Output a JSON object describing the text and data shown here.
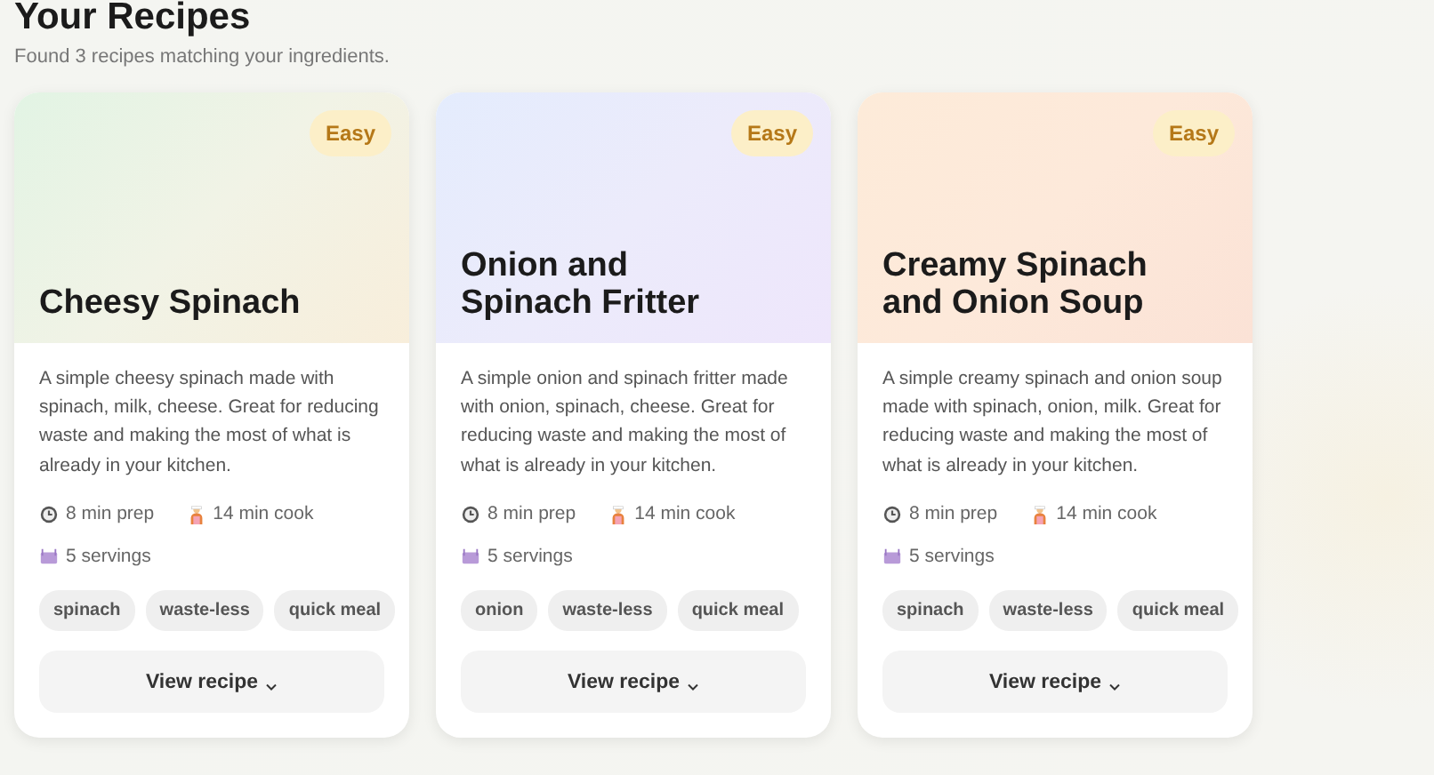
{
  "title": "Your Recipes",
  "subtitle": "Found 3 recipes matching your ingredients.",
  "recipes": [
    {
      "difficulty": "Easy",
      "name": "Cheesy Spinach",
      "description": "A simple cheesy spinach made with spinach, milk, cheese. Great for reducing waste and making the most of what is already in your kitchen.",
      "prep": "8 min prep",
      "cook": "14 min cook",
      "servings": "5 servings",
      "tags": [
        "spinach",
        "waste-less",
        "quick meal"
      ],
      "action": "View recipe"
    },
    {
      "difficulty": "Easy",
      "name": "Onion and Spinach Fritter",
      "description": "A simple onion and spinach fritter made with onion, spinach, cheese. Great for reducing waste and making the most of what is already in your kitchen.",
      "prep": "8 min prep",
      "cook": "14 min cook",
      "servings": "5 servings",
      "tags": [
        "onion",
        "waste-less",
        "quick meal"
      ],
      "action": "View recipe"
    },
    {
      "difficulty": "Easy",
      "name": "Creamy Spinach and Onion Soup",
      "description": "A simple creamy spinach and onion soup made with spinach, onion, milk. Great for reducing waste and making the most of what is already in your kitchen.",
      "prep": "8 min prep",
      "cook": "14 min cook",
      "servings": "5 servings",
      "tags": [
        "spinach",
        "waste-less",
        "quick meal"
      ],
      "action": "View recipe"
    }
  ]
}
